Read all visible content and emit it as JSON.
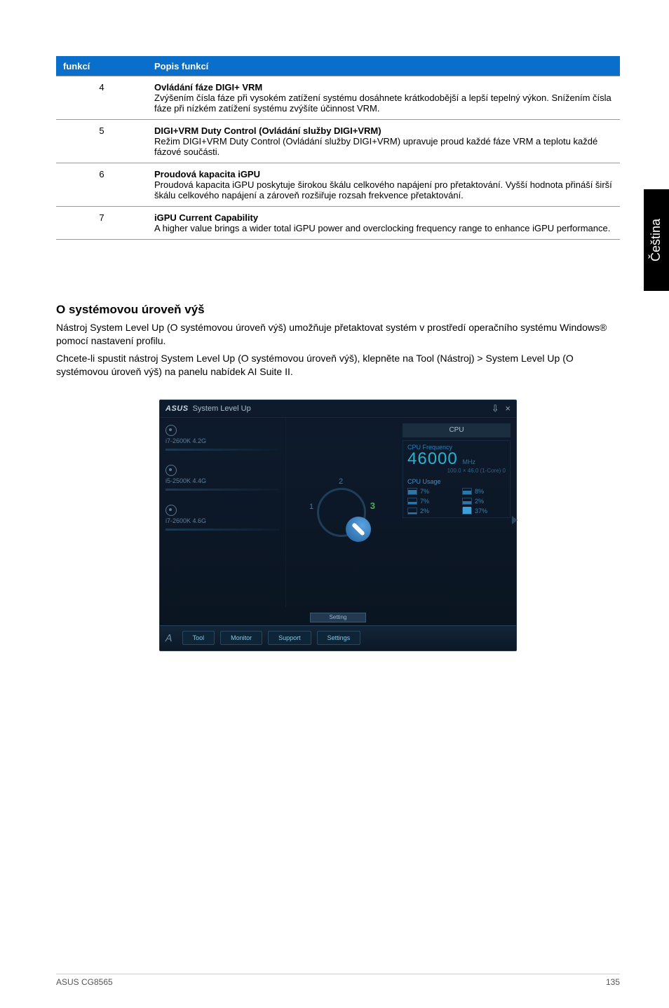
{
  "side_tab": "Čeština",
  "table": {
    "headers": [
      "funkcí",
      "Popis funkcí"
    ],
    "rows": [
      {
        "num": "4",
        "title": "Ovládání fáze DIGI+ VRM",
        "body": "Zvýšením čísla fáze při vysokém zatížení systému dosáhnete krátkodobější a lepší tepelný výkon. Snížením čísla fáze při nízkém zatížení systému zvýšíte účinnost VRM."
      },
      {
        "num": "5",
        "title": "DIGI+VRM Duty Control (Ovládání služby DIGI+VRM)",
        "body": "Režim DIGI+VRM Duty Control (Ovládání služby DIGI+VRM) upravuje proud každé fáze VRM a teplotu každé fázové součásti."
      },
      {
        "num": "6",
        "title": "Proudová kapacita iGPU",
        "body": "Proudová kapacita iGPU poskytuje širokou škálu celkového napájení pro přetaktování. Vyšší hodnota přináší širší škálu celkového napájení a zároveň rozšiřuje rozsah frekvence přetaktování."
      },
      {
        "num": "7",
        "title": "iGPU Current Capability",
        "body": "A higher value brings a wider total iGPU power and overclocking frequency range to enhance iGPU performance."
      }
    ]
  },
  "section": {
    "heading": "O systémovou úroveň výš",
    "p1": "Nástroj System Level Up (O systémovou úroveň výš) umožňuje přetaktovat systém v prostředí operačního systému Windows® pomocí nastavení profilu.",
    "p2": "Chcete-li spustit nástroj System Level Up (O systémovou úroveň výš), klepněte na Tool (Nástroj) > System Level Up (O systémovou úroveň výš) na panelu nabídek AI Suite II."
  },
  "app": {
    "logo": "ASUS",
    "title": "System Level Up",
    "profiles": [
      "i7-2600K 4.2G",
      "i5-2500K 4.4G",
      "i7-2600K 4.6G"
    ],
    "ring": {
      "n1": "1",
      "n2": "2",
      "n3": "3"
    },
    "cpu_header": "CPU",
    "cpu_freq_label": "CPU Frequency",
    "cpu_freq_value": "46000",
    "cpu_freq_unit": "MHz",
    "cpu_sub": "100.0 × 46.0 (1-Core) 0",
    "cpu_usage_label": "CPU Usage",
    "cores": [
      "7%",
      "8%",
      "7%",
      "2%",
      "2%",
      "37%"
    ],
    "setting_btn": "Setting",
    "bottomTabs": [
      "Tool",
      "Monitor",
      "Support",
      "Settings"
    ]
  },
  "footer": {
    "left": "ASUS CG8565",
    "right": "135"
  }
}
